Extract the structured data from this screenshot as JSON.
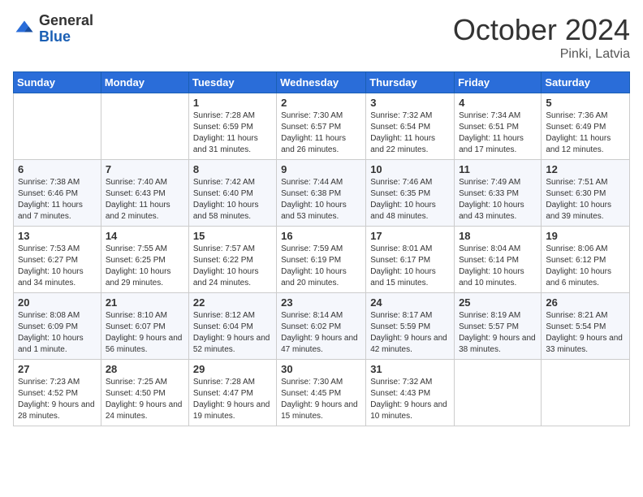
{
  "logo": {
    "general": "General",
    "blue": "Blue"
  },
  "title": "October 2024",
  "location": "Pinki, Latvia",
  "weekdays": [
    "Sunday",
    "Monday",
    "Tuesday",
    "Wednesday",
    "Thursday",
    "Friday",
    "Saturday"
  ],
  "weeks": [
    [
      {
        "day": "",
        "info": ""
      },
      {
        "day": "",
        "info": ""
      },
      {
        "day": "1",
        "info": "Sunrise: 7:28 AM\nSunset: 6:59 PM\nDaylight: 11 hours and 31 minutes."
      },
      {
        "day": "2",
        "info": "Sunrise: 7:30 AM\nSunset: 6:57 PM\nDaylight: 11 hours and 26 minutes."
      },
      {
        "day": "3",
        "info": "Sunrise: 7:32 AM\nSunset: 6:54 PM\nDaylight: 11 hours and 22 minutes."
      },
      {
        "day": "4",
        "info": "Sunrise: 7:34 AM\nSunset: 6:51 PM\nDaylight: 11 hours and 17 minutes."
      },
      {
        "day": "5",
        "info": "Sunrise: 7:36 AM\nSunset: 6:49 PM\nDaylight: 11 hours and 12 minutes."
      }
    ],
    [
      {
        "day": "6",
        "info": "Sunrise: 7:38 AM\nSunset: 6:46 PM\nDaylight: 11 hours and 7 minutes."
      },
      {
        "day": "7",
        "info": "Sunrise: 7:40 AM\nSunset: 6:43 PM\nDaylight: 11 hours and 2 minutes."
      },
      {
        "day": "8",
        "info": "Sunrise: 7:42 AM\nSunset: 6:40 PM\nDaylight: 10 hours and 58 minutes."
      },
      {
        "day": "9",
        "info": "Sunrise: 7:44 AM\nSunset: 6:38 PM\nDaylight: 10 hours and 53 minutes."
      },
      {
        "day": "10",
        "info": "Sunrise: 7:46 AM\nSunset: 6:35 PM\nDaylight: 10 hours and 48 minutes."
      },
      {
        "day": "11",
        "info": "Sunrise: 7:49 AM\nSunset: 6:33 PM\nDaylight: 10 hours and 43 minutes."
      },
      {
        "day": "12",
        "info": "Sunrise: 7:51 AM\nSunset: 6:30 PM\nDaylight: 10 hours and 39 minutes."
      }
    ],
    [
      {
        "day": "13",
        "info": "Sunrise: 7:53 AM\nSunset: 6:27 PM\nDaylight: 10 hours and 34 minutes."
      },
      {
        "day": "14",
        "info": "Sunrise: 7:55 AM\nSunset: 6:25 PM\nDaylight: 10 hours and 29 minutes."
      },
      {
        "day": "15",
        "info": "Sunrise: 7:57 AM\nSunset: 6:22 PM\nDaylight: 10 hours and 24 minutes."
      },
      {
        "day": "16",
        "info": "Sunrise: 7:59 AM\nSunset: 6:19 PM\nDaylight: 10 hours and 20 minutes."
      },
      {
        "day": "17",
        "info": "Sunrise: 8:01 AM\nSunset: 6:17 PM\nDaylight: 10 hours and 15 minutes."
      },
      {
        "day": "18",
        "info": "Sunrise: 8:04 AM\nSunset: 6:14 PM\nDaylight: 10 hours and 10 minutes."
      },
      {
        "day": "19",
        "info": "Sunrise: 8:06 AM\nSunset: 6:12 PM\nDaylight: 10 hours and 6 minutes."
      }
    ],
    [
      {
        "day": "20",
        "info": "Sunrise: 8:08 AM\nSunset: 6:09 PM\nDaylight: 10 hours and 1 minute."
      },
      {
        "day": "21",
        "info": "Sunrise: 8:10 AM\nSunset: 6:07 PM\nDaylight: 9 hours and 56 minutes."
      },
      {
        "day": "22",
        "info": "Sunrise: 8:12 AM\nSunset: 6:04 PM\nDaylight: 9 hours and 52 minutes."
      },
      {
        "day": "23",
        "info": "Sunrise: 8:14 AM\nSunset: 6:02 PM\nDaylight: 9 hours and 47 minutes."
      },
      {
        "day": "24",
        "info": "Sunrise: 8:17 AM\nSunset: 5:59 PM\nDaylight: 9 hours and 42 minutes."
      },
      {
        "day": "25",
        "info": "Sunrise: 8:19 AM\nSunset: 5:57 PM\nDaylight: 9 hours and 38 minutes."
      },
      {
        "day": "26",
        "info": "Sunrise: 8:21 AM\nSunset: 5:54 PM\nDaylight: 9 hours and 33 minutes."
      }
    ],
    [
      {
        "day": "27",
        "info": "Sunrise: 7:23 AM\nSunset: 4:52 PM\nDaylight: 9 hours and 28 minutes."
      },
      {
        "day": "28",
        "info": "Sunrise: 7:25 AM\nSunset: 4:50 PM\nDaylight: 9 hours and 24 minutes."
      },
      {
        "day": "29",
        "info": "Sunrise: 7:28 AM\nSunset: 4:47 PM\nDaylight: 9 hours and 19 minutes."
      },
      {
        "day": "30",
        "info": "Sunrise: 7:30 AM\nSunset: 4:45 PM\nDaylight: 9 hours and 15 minutes."
      },
      {
        "day": "31",
        "info": "Sunrise: 7:32 AM\nSunset: 4:43 PM\nDaylight: 9 hours and 10 minutes."
      },
      {
        "day": "",
        "info": ""
      },
      {
        "day": "",
        "info": ""
      }
    ]
  ]
}
